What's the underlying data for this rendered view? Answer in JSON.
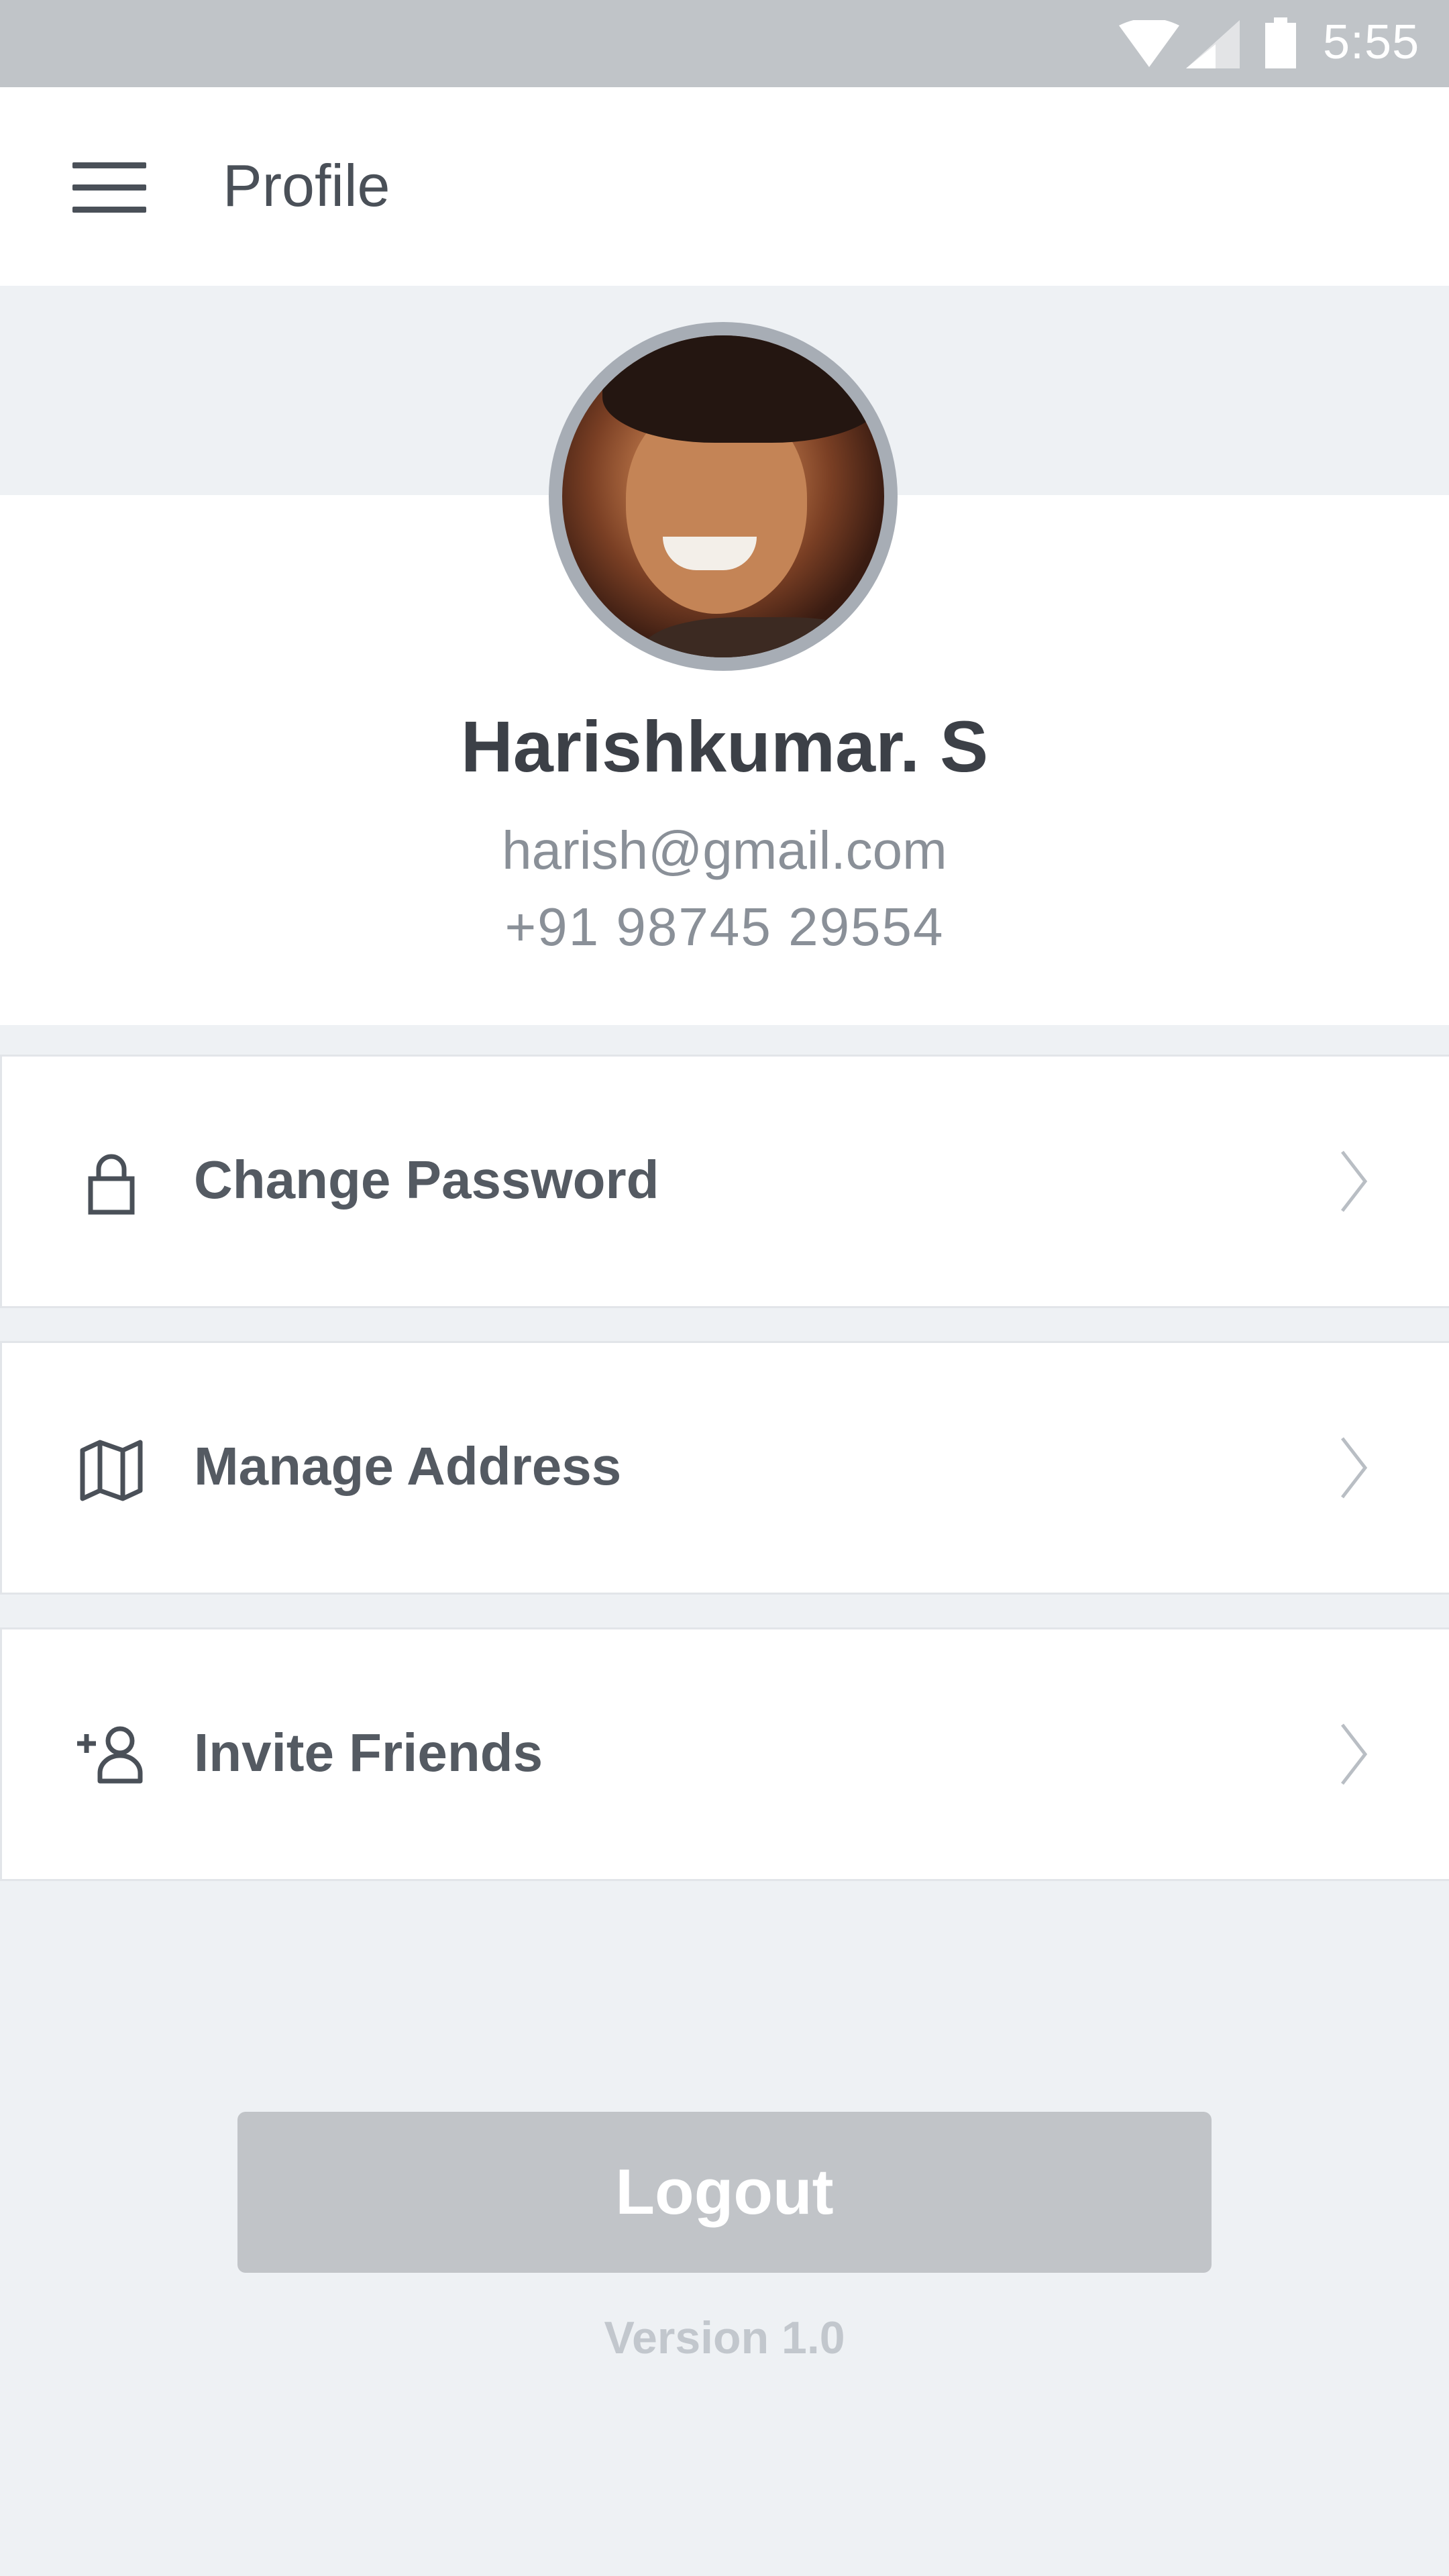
{
  "status_bar": {
    "time": "5:55",
    "icons": [
      "wifi-icon",
      "cell-signal-icon",
      "battery-icon"
    ]
  },
  "app_bar": {
    "title": "Profile",
    "menu_icon": "hamburger-menu-icon"
  },
  "profile": {
    "name": "Harishkumar. S",
    "email": "harish@gmail.com",
    "phone": "+91 98745 29554"
  },
  "menu": {
    "items": [
      {
        "label": "Change Password",
        "icon": "lock-icon"
      },
      {
        "label": "Manage Address",
        "icon": "map-icon"
      },
      {
        "label": "Invite Friends",
        "icon": "add-friend-icon"
      }
    ]
  },
  "footer": {
    "logout_label": "Logout",
    "version": "Version 1.0"
  },
  "colors": {
    "status_bar": "#c0c4c8",
    "background": "#eef1f4",
    "logout_button": "#c1c4c8",
    "text_primary": "#3c4047",
    "text_secondary": "#8a9098"
  }
}
